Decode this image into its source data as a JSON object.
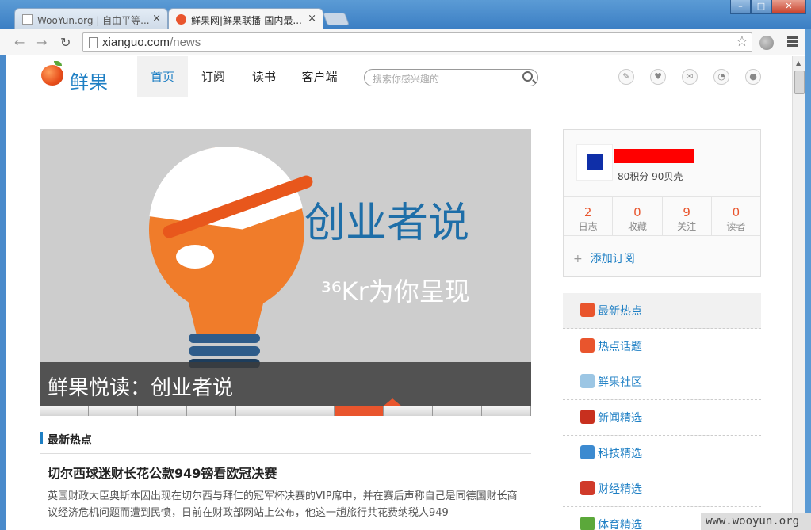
{
  "browser": {
    "tabs": [
      {
        "title": "WooYun.org | 自由平等...",
        "active": false
      },
      {
        "title": "鲜果网|鲜果联播-国内最...",
        "active": true
      }
    ],
    "close_glyph": "×",
    "url_host": "xianguo.com",
    "url_path": "/news"
  },
  "site": {
    "logo_text": "鲜果",
    "nav": [
      "首页",
      "订阅",
      "读书",
      "客户端"
    ],
    "search_placeholder": "搜索你感兴趣的",
    "header_icons": [
      "edit-icon",
      "heart-icon",
      "mail-icon",
      "rss-icon",
      "user-icon"
    ]
  },
  "banner": {
    "graphic_title": "创业者说",
    "graphic_sub": "³⁶Kr为你呈现",
    "caption": "鲜果悦读：创业者说",
    "page_count": 10,
    "active_page": 7
  },
  "latest": {
    "section_title": "最新热点",
    "article_title": "切尔西球迷财长花公款949镑看欧冠决赛",
    "article_excerpt": "英国财政大臣奥斯本因出现在切尔西与拜仁的冠军杯决赛的VIP席中，并在赛后声称自己是同德国财长商议经济危机问题而遭到民愤，日前在财政部网站上公布，他这一趟旅行共花费纳税人949"
  },
  "profile": {
    "points": "80积分  90贝壳",
    "stats": [
      {
        "num": "2",
        "label": "日志"
      },
      {
        "num": "0",
        "label": "收藏"
      },
      {
        "num": "9",
        "label": "关注"
      },
      {
        "num": "0",
        "label": "读者"
      }
    ],
    "add_subscription": "添加订阅"
  },
  "sidebar": {
    "items": [
      {
        "label": "最新热点",
        "color": "#e9552d"
      },
      {
        "label": "热点话题",
        "color": "#e9552d"
      },
      {
        "label": "鲜果社区",
        "color": "#9cc6e4"
      },
      {
        "label": "新闻精选",
        "color": "#c8301e"
      },
      {
        "label": "科技精选",
        "color": "#3c8ad0"
      },
      {
        "label": "财经精选",
        "color": "#d03a2a"
      },
      {
        "label": "体育精选",
        "color": "#5ba83a"
      }
    ]
  },
  "watermark": "www.wooyun.org"
}
